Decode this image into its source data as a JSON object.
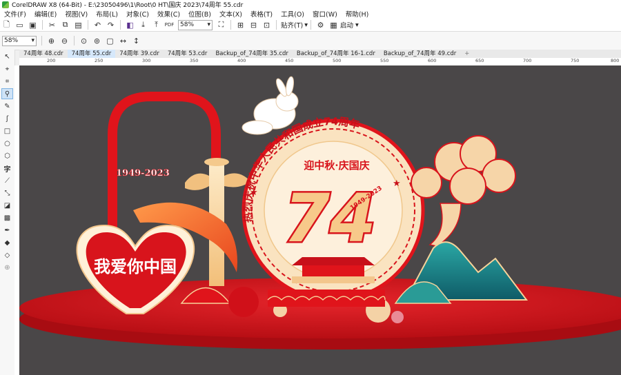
{
  "window": {
    "title": "CorelDRAW X8 (64-Bit) - E:\\23050496\\1\\Root\\0 HT\\国庆 2023\\74周年 55.cdr"
  },
  "menu": [
    "文件(F)",
    "编辑(E)",
    "视图(V)",
    "布局(L)",
    "对象(C)",
    "效果(C)",
    "位图(B)",
    "文本(X)",
    "表格(T)",
    "工具(O)",
    "窗口(W)",
    "帮助(H)"
  ],
  "toolbar": {
    "zoom_value": "58%",
    "snap_label": "贴齐(T)",
    "launch_label": "启动"
  },
  "property_bar": {
    "zoom_value": "58%"
  },
  "tabs": [
    "74周年 48.cdr",
    "74周年 55.cdr",
    "74周年 39.cdr",
    "74周年 53.cdr",
    "Backup_of_74周年 35.cdr",
    "Backup_of_74周年 16-1.cdr",
    "Backup_of_74周年 49.cdr"
  ],
  "active_tab": 1,
  "ruler_marks": [
    "200",
    "250",
    "300",
    "350",
    "400",
    "450",
    "500",
    "550",
    "600",
    "650",
    "700",
    "750",
    "800"
  ],
  "artwork": {
    "year_tag": "1949-2023",
    "arc_text": "热烈庆祝中华人民共和国成立74周年",
    "slogan": "迎中秋·庆国庆",
    "big_number": "74",
    "number_year": "1949-2023",
    "heart_text": "我爱你中国",
    "colors": {
      "red": "#d8141c",
      "gold": "#f7d39a",
      "cream": "#fbe6c4",
      "teal": "#1d8a88",
      "canvas": "#4a4748"
    }
  }
}
